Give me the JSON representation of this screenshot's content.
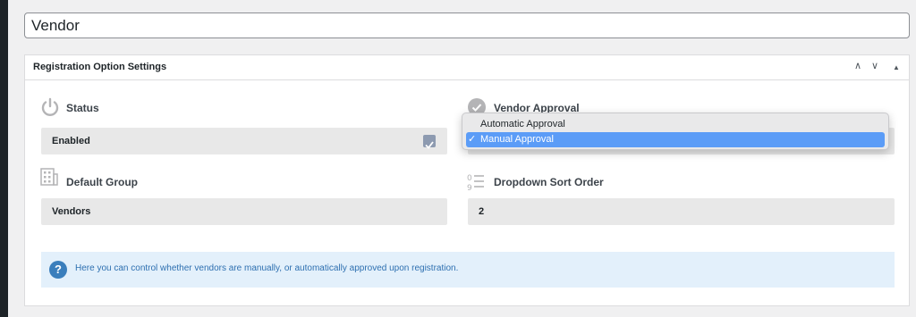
{
  "post_title": {
    "value": "Vendor"
  },
  "metabox": {
    "title": "Registration Option Settings",
    "controls": {
      "up": "∧",
      "down": "∨",
      "toggle": "▲"
    }
  },
  "fields": {
    "status": {
      "label": "Status",
      "value": "Enabled",
      "checked": true
    },
    "vendor_approval": {
      "label": "Vendor Approval"
    },
    "default_group": {
      "label": "Default Group",
      "value": "Vendors"
    },
    "dropdown_sort_order": {
      "label": "Dropdown Sort Order",
      "value": "2"
    }
  },
  "approval_dropdown": {
    "options": [
      {
        "label": "Automatic Approval",
        "check": ""
      },
      {
        "label": "Manual Approval",
        "check": "✓"
      }
    ],
    "selected": "Manual Approval"
  },
  "info": {
    "icon": "?",
    "text": "Here you can control whether vendors are manually, or automatically approved upon registration."
  },
  "colors": {
    "info_bg": "#e3f0fb",
    "info_text": "#2d6fb0",
    "selection": "#5b9cf7"
  }
}
